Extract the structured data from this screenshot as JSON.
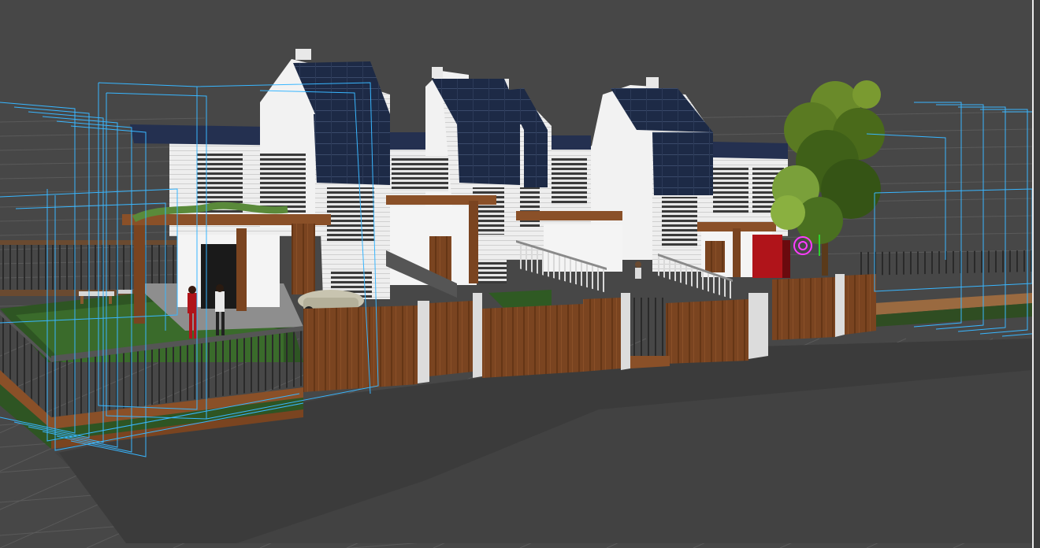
{
  "viewport": {
    "view": "perspective",
    "shading": "realistic",
    "background_color": "#474747",
    "grid_color": "#5a5a5a",
    "selection_box_color": "#38b6ff",
    "gizmo_color": "#ff3cff",
    "scene_objects": [
      "rowhouse-block",
      "solar-panels",
      "wood-pergola",
      "wood-fence",
      "metal-railing",
      "lawn",
      "tree",
      "people",
      "car",
      "picnic-table",
      "red-door"
    ]
  }
}
